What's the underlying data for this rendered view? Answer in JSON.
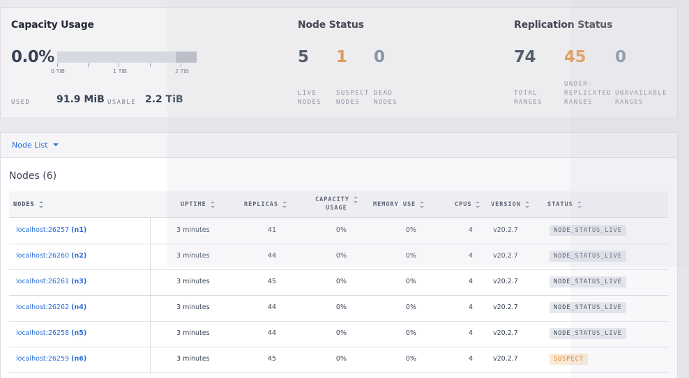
{
  "capacity": {
    "title": "Capacity Usage",
    "percent": "0.0%",
    "used_fraction": 0.0,
    "ticks": [
      "0 TiB",
      "1 TiB",
      "2 TiB"
    ],
    "used_label": "USED",
    "used_value": "91.9 MiB",
    "usable_label": "USABLE",
    "usable_value": "2.2 TiB"
  },
  "node_status": {
    "title": "Node Status",
    "live": "5",
    "live_label_1": "LIVE",
    "live_label_2": "NODES",
    "suspect": "1",
    "suspect_label_1": "SUSPECT",
    "suspect_label_2": "NODES",
    "dead": "0",
    "dead_label_1": "DEAD",
    "dead_label_2": "NODES"
  },
  "replication": {
    "title": "Replication Status",
    "total": "74",
    "total_label_1": "TOTAL",
    "total_label_2": "RANGES",
    "under": "45",
    "under_label_1": "UNDER-",
    "under_label_2": "REPLICATED",
    "under_label_3": "RANGES",
    "unavailable": "0",
    "unavailable_label_1": "UNAVAILABLE",
    "unavailable_label_2": "RANGES"
  },
  "nodelist": {
    "label": "Node List"
  },
  "table": {
    "title": "Nodes (6)",
    "headers": {
      "nodes": "NODES",
      "uptime": "UPTIME",
      "replicas": "REPLICAS",
      "capacity_1": "CAPACITY",
      "capacity_2": "USAGE",
      "memory": "MEMORY USE",
      "cpus": "CPUS",
      "version": "VERSION",
      "status": "STATUS"
    },
    "rows": [
      {
        "host": "localhost:26257",
        "id": "(n1)",
        "uptime": "3 minutes",
        "replicas": "41",
        "capacity": "0%",
        "memory": "0%",
        "cpus": "4",
        "version": "v20.2.7",
        "status": "NODE_STATUS_LIVE"
      },
      {
        "host": "localhost:26260",
        "id": "(n2)",
        "uptime": "3 minutes",
        "replicas": "44",
        "capacity": "0%",
        "memory": "0%",
        "cpus": "4",
        "version": "v20.2.7",
        "status": "NODE_STATUS_LIVE"
      },
      {
        "host": "localhost:26261",
        "id": "(n3)",
        "uptime": "3 minutes",
        "replicas": "45",
        "capacity": "0%",
        "memory": "0%",
        "cpus": "4",
        "version": "v20.2.7",
        "status": "NODE_STATUS_LIVE"
      },
      {
        "host": "localhost:26262",
        "id": "(n4)",
        "uptime": "3 minutes",
        "replicas": "44",
        "capacity": "0%",
        "memory": "0%",
        "cpus": "4",
        "version": "v20.2.7",
        "status": "NODE_STATUS_LIVE"
      },
      {
        "host": "localhost:26258",
        "id": "(n5)",
        "uptime": "3 minutes",
        "replicas": "44",
        "capacity": "0%",
        "memory": "0%",
        "cpus": "4",
        "version": "v20.2.7",
        "status": "NODE_STATUS_LIVE"
      },
      {
        "host": "localhost:26259",
        "id": "(n6)",
        "uptime": "3 minutes",
        "replicas": "45",
        "capacity": "0%",
        "memory": "0%",
        "cpus": "4",
        "version": "v20.2.7",
        "status": "SUSPECT"
      }
    ]
  },
  "colors": {
    "accent_blue": "#2b6ed6",
    "suspect_orange": "#e0913b",
    "dead_gray": "#7b879b"
  }
}
